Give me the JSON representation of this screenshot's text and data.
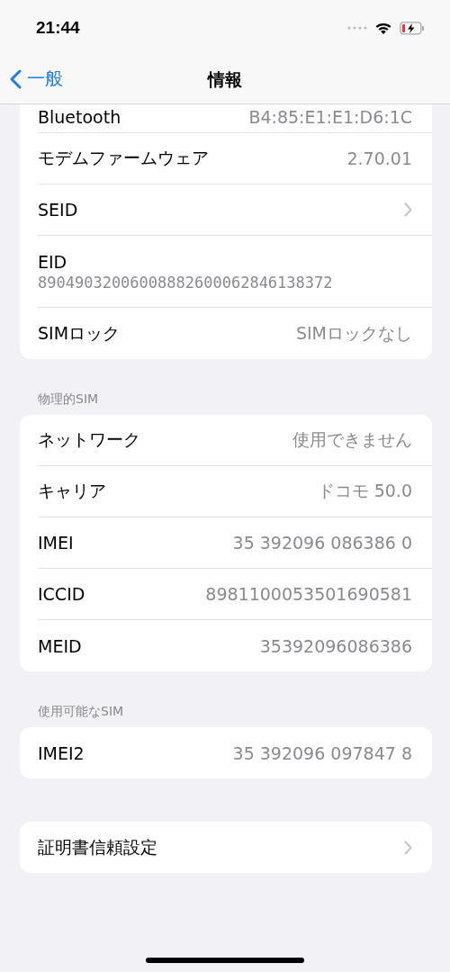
{
  "status_bar": {
    "time": "21:44",
    "battery_charging": true
  },
  "nav": {
    "back": "一般",
    "title": "情報"
  },
  "sections": [
    {
      "rows": [
        {
          "kind": "cut",
          "label": "Bluetooth",
          "value": "B4:85:E1:E1:D6:1C"
        },
        {
          "kind": "value",
          "label": "モデムファームウェア",
          "value": "2.70.01"
        },
        {
          "kind": "link",
          "label": "SEID"
        },
        {
          "kind": "stacked",
          "label": "EID",
          "value": "89049032006008882600062846138372"
        },
        {
          "kind": "value",
          "label": "SIMロック",
          "value": "SIMロックなし"
        }
      ]
    },
    {
      "header": "物理的SIM",
      "rows": [
        {
          "kind": "value",
          "label": "ネットワーク",
          "value": "使用できません"
        },
        {
          "kind": "value",
          "label": "キャリア",
          "value": "ドコモ 50.0"
        },
        {
          "kind": "value",
          "label": "IMEI",
          "value": "35 392096 086386 0"
        },
        {
          "kind": "value",
          "label": "ICCID",
          "value": "8981100053501690581"
        },
        {
          "kind": "value",
          "label": "MEID",
          "value": "35392096086386"
        }
      ]
    },
    {
      "header": "使用可能なSIM",
      "rows": [
        {
          "kind": "value",
          "label": "IMEI2",
          "value": "35 392096 097847 8"
        }
      ]
    },
    {
      "rows": [
        {
          "kind": "link",
          "label": "証明書信頼設定"
        }
      ]
    }
  ]
}
